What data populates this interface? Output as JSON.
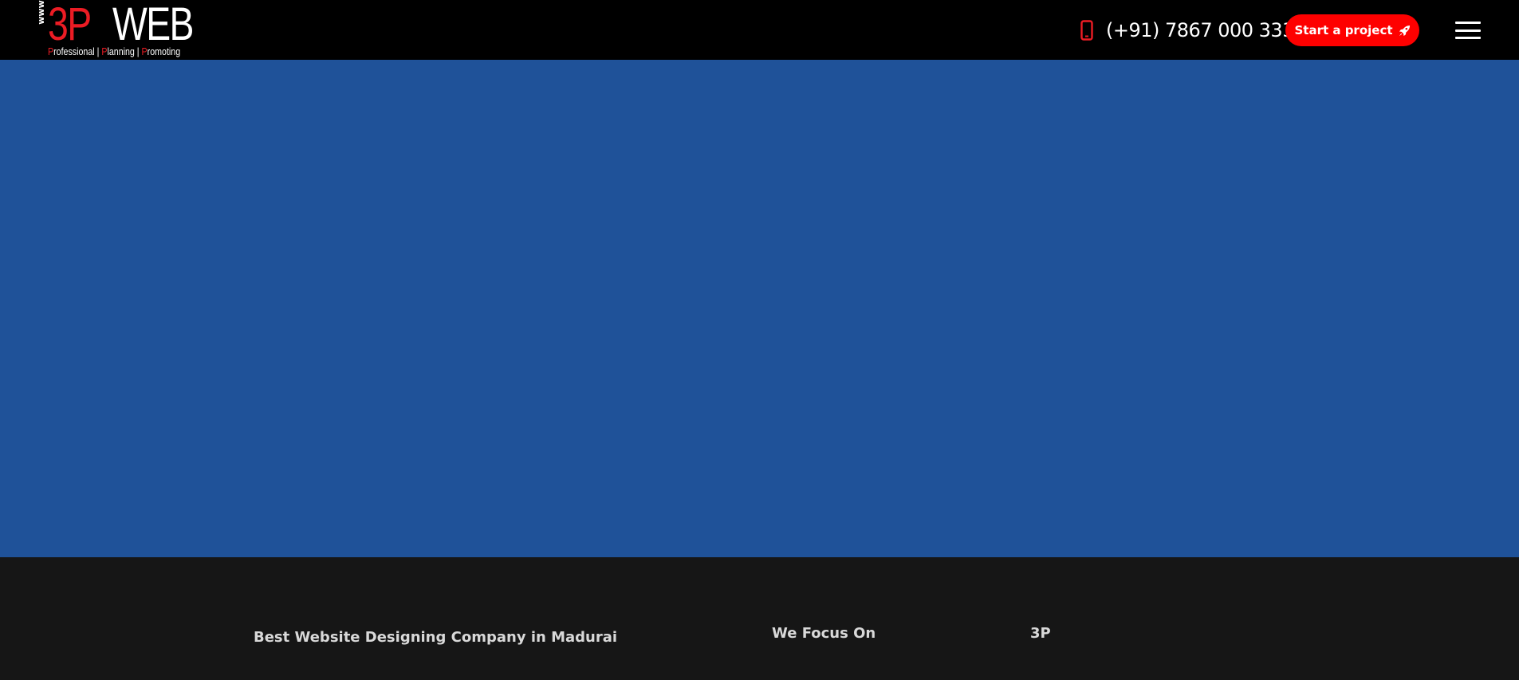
{
  "header": {
    "logo": {
      "www": "www",
      "brand_red": "3P",
      "brand_white": "WEB",
      "tagline_parts": [
        {
          "first": "P",
          "rest": "rofessional | "
        },
        {
          "first": "P",
          "rest": "lanning | "
        },
        {
          "first": "P",
          "rest": "romoting"
        }
      ]
    },
    "phone": {
      "icon": "mobile-phone-icon",
      "number": "(+91) 7867 000 333"
    },
    "cta": {
      "label": "Start a project",
      "icon": "rocket-icon"
    },
    "menu": {
      "icon": "hamburger-menu-icon"
    }
  },
  "hero": {},
  "footer": {
    "columns": [
      {
        "heading": "Best Website Designing Company in Madurai"
      },
      {
        "heading": "We Focus On"
      },
      {
        "heading": "3P"
      }
    ]
  },
  "colors": {
    "header_bg": "#000000",
    "brand_red": "#ec1c24",
    "cta_bg": "#fe0000",
    "hero_bg": "#1f5299",
    "footer_bg": "#161616",
    "footer_text": "#d9d9d9"
  }
}
